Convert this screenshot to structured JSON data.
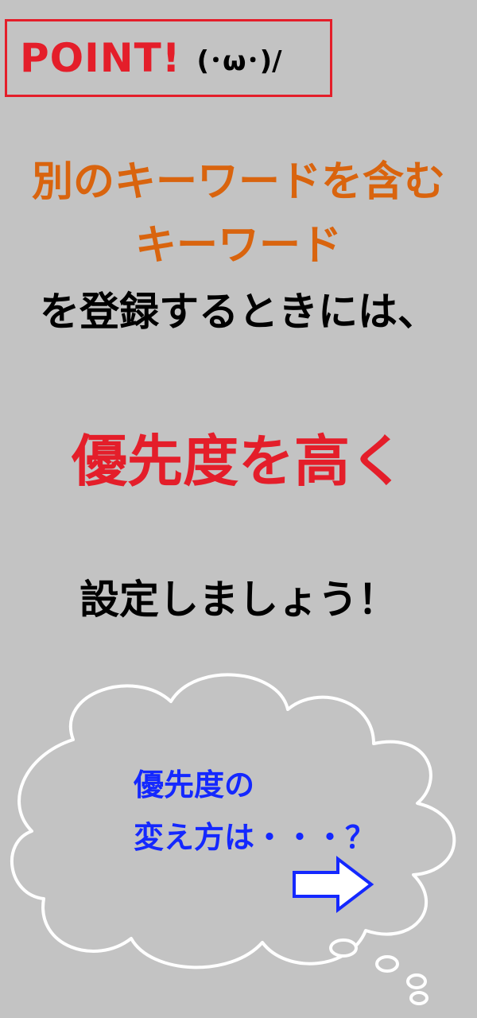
{
  "point": {
    "word": "POINT!",
    "face": "(･ω･)/"
  },
  "lines": [
    "別のキーワードを含む",
    "キーワード",
    "を登録するときには、",
    "優先度を高く",
    "設定しましょう！"
  ],
  "cloud": {
    "lines": [
      "優先度の",
      "変え方は・・・？"
    ],
    "arrow": "arrow-right-icon"
  },
  "colors": {
    "background": "#c3c3c3",
    "red": "#e41e2a",
    "orange": "#d9640e",
    "blue": "#1428ff"
  }
}
